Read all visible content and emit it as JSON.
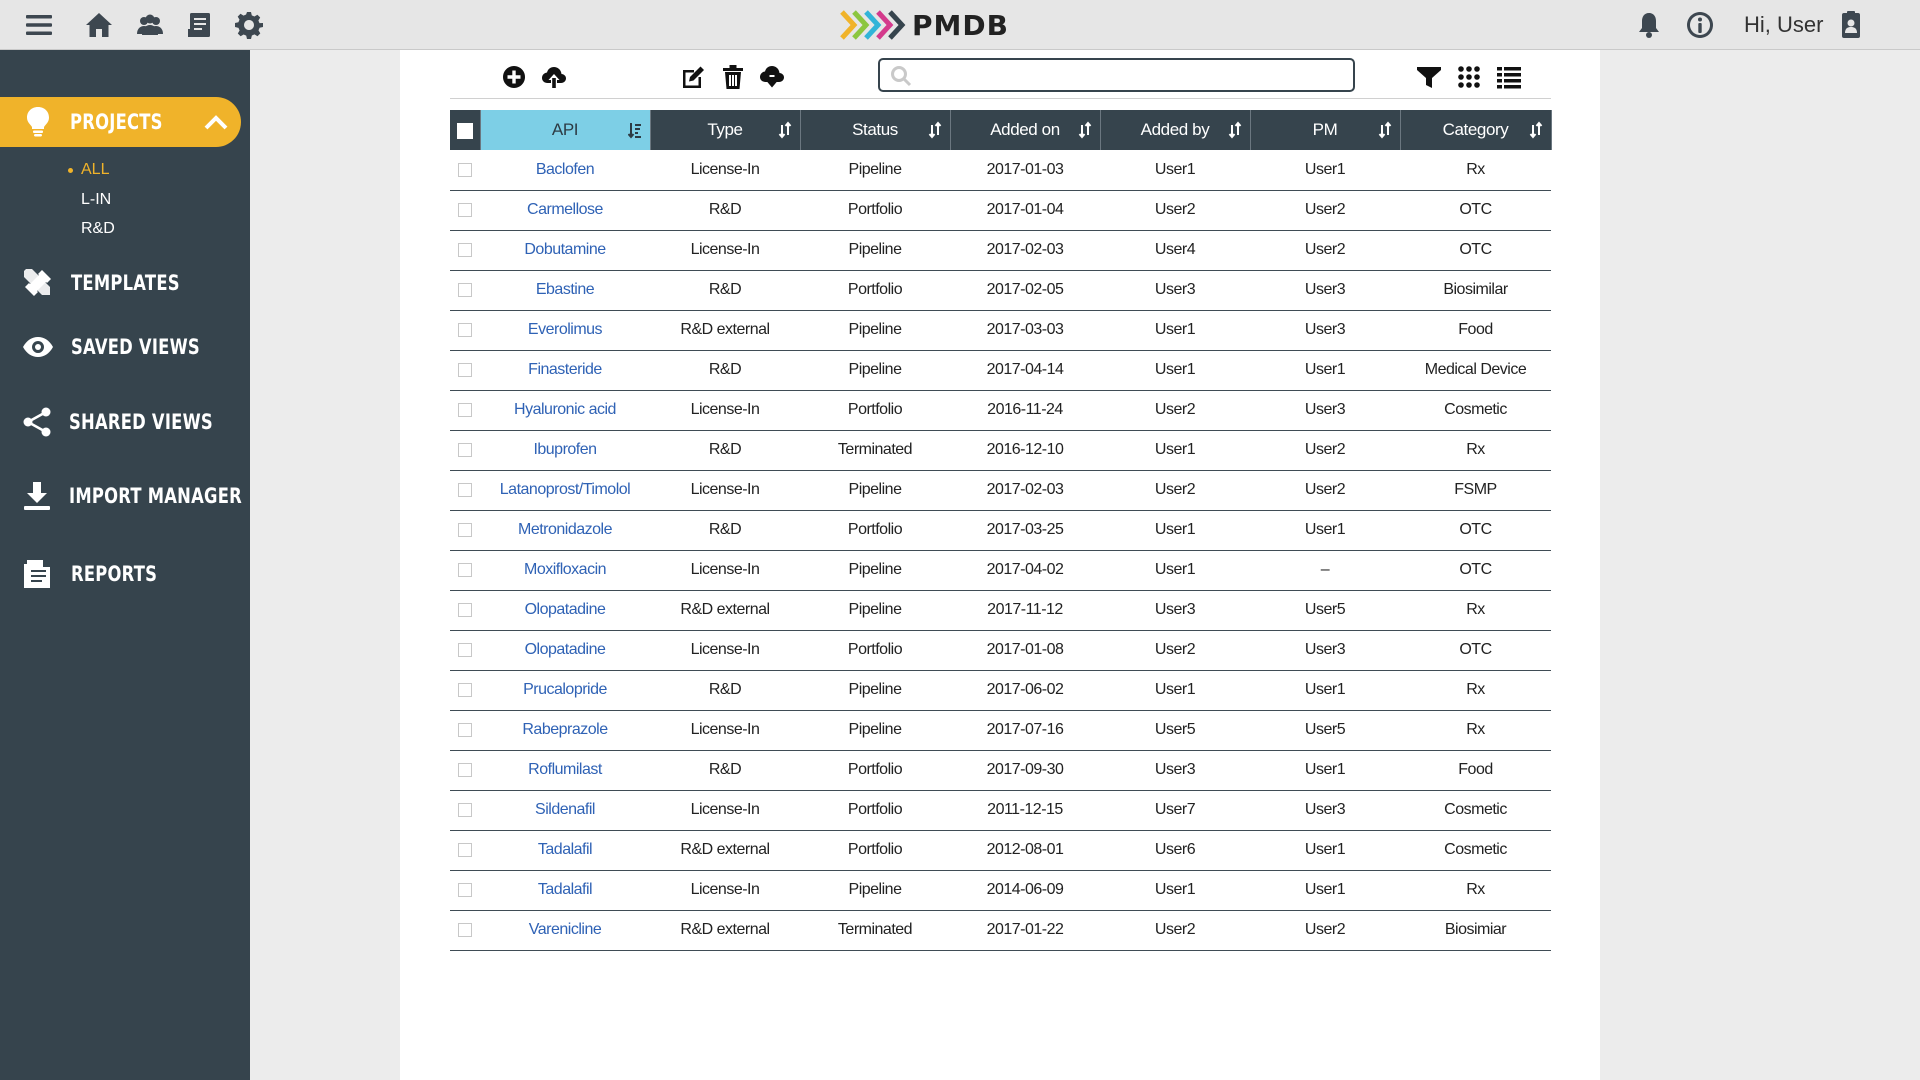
{
  "app": {
    "title": "PMDB",
    "greeting": "Hi, User"
  },
  "topbar": {
    "left_icons": [
      "menu-icon",
      "home-icon",
      "users-icon",
      "documents-icon",
      "gear-icon"
    ],
    "right_icons": [
      "bell-icon",
      "info-icon",
      "user-badge-icon"
    ]
  },
  "colors": {
    "sidebar": "#36444d",
    "accent": "#f0b32a",
    "sorted_header": "#7dcfe6",
    "link": "#2f62b5",
    "logo_arrows": [
      "#f0b32a",
      "#8cc63f",
      "#32b4d8",
      "#d43a8c",
      "#36444d"
    ]
  },
  "sidebar": {
    "active": {
      "label": "PROJECTS",
      "icon": "lightbulb-icon"
    },
    "subitems": [
      {
        "label": "ALL",
        "active": true
      },
      {
        "label": "L-IN",
        "active": false
      },
      {
        "label": "R&D",
        "active": false
      }
    ],
    "items": [
      {
        "label": "TEMPLATES",
        "icon": "tools-icon"
      },
      {
        "label": "SAVED VIEWS",
        "icon": "eye-icon"
      },
      {
        "label": "SHARED VIEWS",
        "icon": "share-icon"
      },
      {
        "label": "IMPORT MANAGER",
        "icon": "download-icon"
      },
      {
        "label": "REPORTS",
        "icon": "report-icon"
      }
    ]
  },
  "toolbar": {
    "left_icons": [
      "add-icon",
      "upload-icon",
      "edit-icon",
      "delete-icon",
      "cloud-download-icon"
    ],
    "right_icons": [
      "filter-icon",
      "grid-view-icon",
      "list-view-icon"
    ],
    "search": {
      "value": "",
      "placeholder": ""
    }
  },
  "table": {
    "columns": [
      "API",
      "Type",
      "Status",
      "Added on",
      "Added by",
      "PM",
      "Category"
    ],
    "sorted_column": "API",
    "rows": [
      [
        "Baclofen",
        "License-In",
        "Pipeline",
        "2017-01-03",
        "User1",
        "User1",
        "Rx"
      ],
      [
        "Carmellose",
        "R&D",
        "Portfolio",
        "2017-01-04",
        "User2",
        "User2",
        "OTC"
      ],
      [
        "Dobutamine",
        "License-In",
        "Pipeline",
        "2017-02-03",
        "User4",
        "User2",
        "OTC"
      ],
      [
        "Ebastine",
        "R&D",
        "Portfolio",
        "2017-02-05",
        "User3",
        "User3",
        "Biosimilar"
      ],
      [
        "Everolimus",
        "R&D external",
        "Pipeline",
        "2017-03-03",
        "User1",
        "User3",
        "Food"
      ],
      [
        "Finasteride",
        "R&D",
        "Pipeline",
        "2017-04-14",
        "User1",
        "User1",
        "Medical Device"
      ],
      [
        "Hyaluronic acid",
        "License-In",
        "Portfolio",
        "2016-11-24",
        "User2",
        "User3",
        "Cosmetic"
      ],
      [
        "Ibuprofen",
        "R&D",
        "Terminated",
        "2016-12-10",
        "User1",
        "User2",
        "Rx"
      ],
      [
        "Latanoprost/Timolol",
        "License-In",
        "Pipeline",
        "2017-02-03",
        "User2",
        "User2",
        "FSMP"
      ],
      [
        "Metronidazole",
        "R&D",
        "Portfolio",
        "2017-03-25",
        "User1",
        "User1",
        "OTC"
      ],
      [
        "Moxifloxacin",
        "License-In",
        "Pipeline",
        "2017-04-02",
        "User1",
        "–",
        "OTC"
      ],
      [
        "Olopatadine",
        "R&D external",
        "Pipeline",
        "2017-11-12",
        "User3",
        "User5",
        "Rx"
      ],
      [
        "Olopatadine",
        "License-In",
        "Portfolio",
        "2017-01-08",
        "User2",
        "User3",
        "OTC"
      ],
      [
        "Prucalopride",
        "R&D",
        "Pipeline",
        "2017-06-02",
        "User1",
        "User1",
        "Rx"
      ],
      [
        "Rabeprazole",
        "License-In",
        "Pipeline",
        "2017-07-16",
        "User5",
        "User5",
        "Rx"
      ],
      [
        "Roflumilast",
        "R&D",
        "Portfolio",
        "2017-09-30",
        "User3",
        "User1",
        "Food"
      ],
      [
        "Sildenafil",
        "License-In",
        "Portfolio",
        "2011-12-15",
        "User7",
        "User3",
        "Cosmetic"
      ],
      [
        "Tadalafil",
        "R&D external",
        "Portfolio",
        "2012-08-01",
        "User6",
        "User1",
        "Cosmetic"
      ],
      [
        "Tadalafil",
        "License-In",
        "Pipeline",
        "2014-06-09",
        "User1",
        "User1",
        "Rx"
      ],
      [
        "Varenicline",
        "R&D external",
        "Terminated",
        "2017-01-22",
        "User2",
        "User2",
        "Biosimiar"
      ]
    ]
  }
}
